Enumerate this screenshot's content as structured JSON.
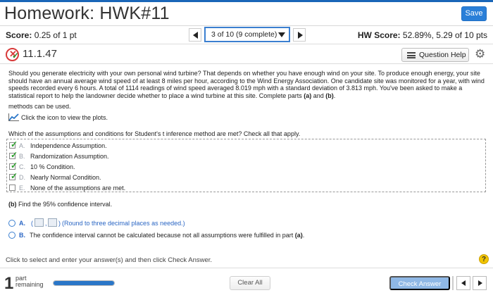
{
  "header": {
    "title": "Homework: HWK#11",
    "save_label": "Save"
  },
  "scorebar": {
    "score_label": "Score:",
    "score_value": "0.25 of 1 pt",
    "question_selector": "3 of 10 (9 complete)",
    "hw_score_label": "HW Score:",
    "hw_score_value": "52.89%, 5.29 of 10 pts"
  },
  "question": {
    "number": "11.1.47",
    "help_label": "Question Help",
    "stem": "Should you generate electricity with your own personal wind turbine? That depends on whether you have enough wind on your site. To produce enough energy, your site should have an annual average wind speed of at least 8 miles per hour, according to the Wind Energy Association. One candidate site was monitored for a year, with wind speeds recorded every 6 hours. A total of 1114 readings of wind speed averaged 8.019 mph with a standard deviation of 3.813 mph. You've been asked to make a statistical report to help the landowner decide whether to place a wind turbine at this site. Complete parts ",
    "stem_part_a": "(a)",
    "stem_and": " and ",
    "stem_part_b": "(b)",
    "stem_end": ".",
    "cut_text": "methods can be used.",
    "plots_text": "Click the icon to view the plots.",
    "which_text": "Which of the assumptions and conditions for Student's t inference method are met? Check all that apply.",
    "choices": [
      {
        "letter": "A.",
        "text": "Independence Assumption.",
        "checked": true
      },
      {
        "letter": "B.",
        "text": "Randomization Assumption.",
        "checked": true
      },
      {
        "letter": "C.",
        "text": "10 % Condition.",
        "checked": true
      },
      {
        "letter": "D.",
        "text": "Nearly Normal Condition.",
        "checked": true
      },
      {
        "letter": "E.",
        "text": "None of the assumptions are met.",
        "checked": false
      }
    ],
    "part_b_label": "(b)",
    "part_b_text": " Find the 95% confidence interval.",
    "option_a_letter": "A.",
    "option_a_open": "(",
    "option_a_comma": ",",
    "option_a_close": ")",
    "option_a_hint": "(Round to three decimal places as needed.)",
    "option_b_letter": "B.",
    "option_b_text": "The confidence interval cannot be calculated because not all assumptions were fulfilled in part ",
    "option_b_part": "(a)",
    "option_b_end": "."
  },
  "instruction": "Click to select and enter your answer(s) and then click Check Answer.",
  "help_glyph": "?",
  "footer": {
    "parts_remaining": "1",
    "part_label": "part",
    "remaining_label": "remaining",
    "progress_fraction": 1.0,
    "clear_all_label": "Clear All",
    "check_answer_label": "Check Answer"
  }
}
